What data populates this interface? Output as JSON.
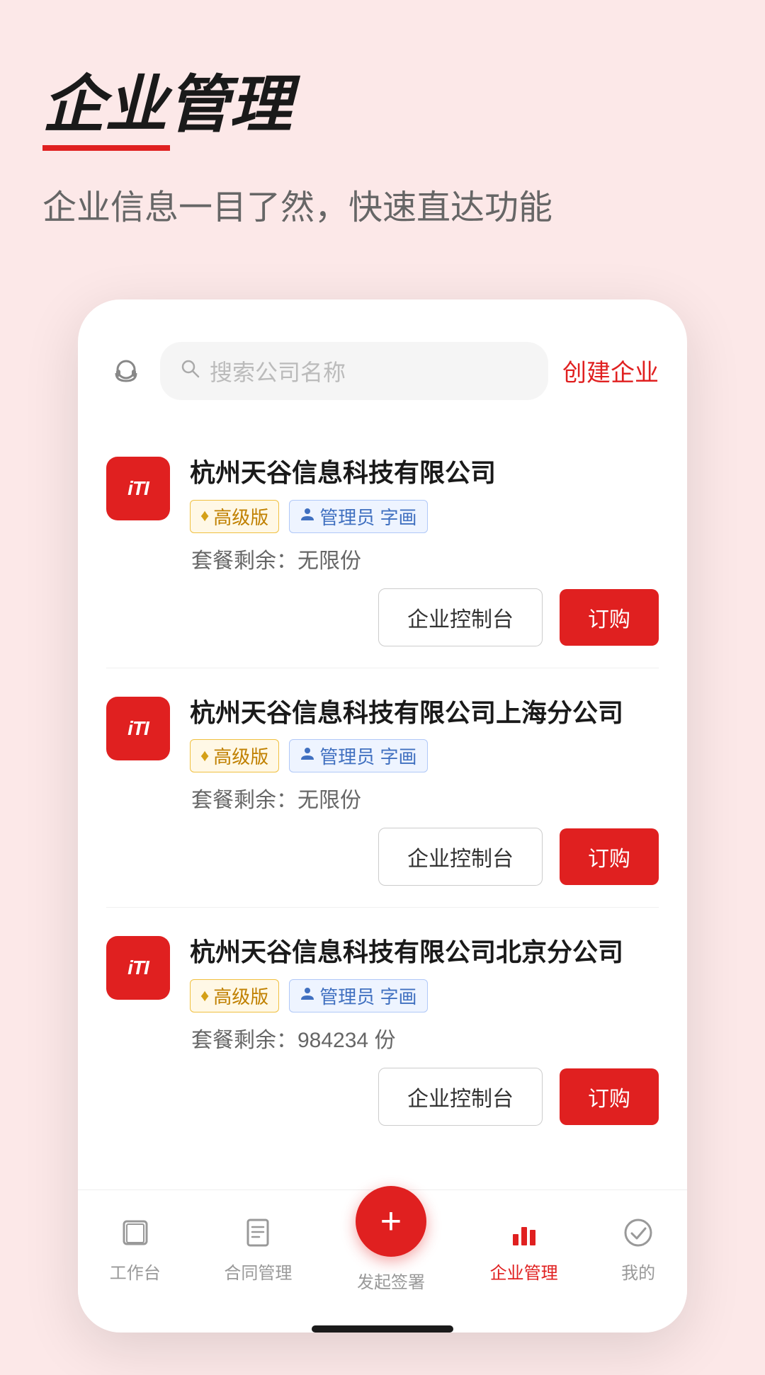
{
  "header": {
    "title": "企业管理",
    "subtitle": "企业信息一目了然，快速直达功能"
  },
  "search": {
    "placeholder": "搜索公司名称",
    "create_label": "创建企业"
  },
  "companies": [
    {
      "id": 1,
      "logo_text": "iTI",
      "name": "杭州天谷信息科技有限公司",
      "tier_label": "高级版",
      "role": "管理员 字画",
      "package_label": "套餐剩余：",
      "package_value": "无限份",
      "btn_dashboard": "企业控制台",
      "btn_order": "订购"
    },
    {
      "id": 2,
      "logo_text": "iTI",
      "name": "杭州天谷信息科技有限公司上海分公司",
      "tier_label": "高级版",
      "role": "管理员 字画",
      "package_label": "套餐剩余：",
      "package_value": "无限份",
      "btn_dashboard": "企业控制台",
      "btn_order": "订购"
    },
    {
      "id": 3,
      "logo_text": "iTI",
      "name": "杭州天谷信息科技有限公司北京分公司",
      "tier_label": "高级版",
      "role": "管理员 字画",
      "package_label": "套餐剩余：",
      "package_value": "984234 份",
      "btn_dashboard": "企业控制台",
      "btn_order": "订购"
    }
  ],
  "nav": {
    "items": [
      {
        "id": "workbench",
        "label": "工作台",
        "active": false
      },
      {
        "id": "contract",
        "label": "合同管理",
        "active": false
      },
      {
        "id": "sign",
        "label": "发起签署",
        "active": false,
        "is_center": true
      },
      {
        "id": "enterprise",
        "label": "企业管理",
        "active": true
      },
      {
        "id": "mine",
        "label": "我的",
        "active": false
      }
    ]
  },
  "icons": {
    "headset": "🎧",
    "search": "🔍",
    "diamond": "♦",
    "person": "👤",
    "workbench_icon": "⊡",
    "contract_icon": "☰",
    "plus_icon": "+",
    "enterprise_icon": "📊",
    "mine_icon": "✓"
  }
}
